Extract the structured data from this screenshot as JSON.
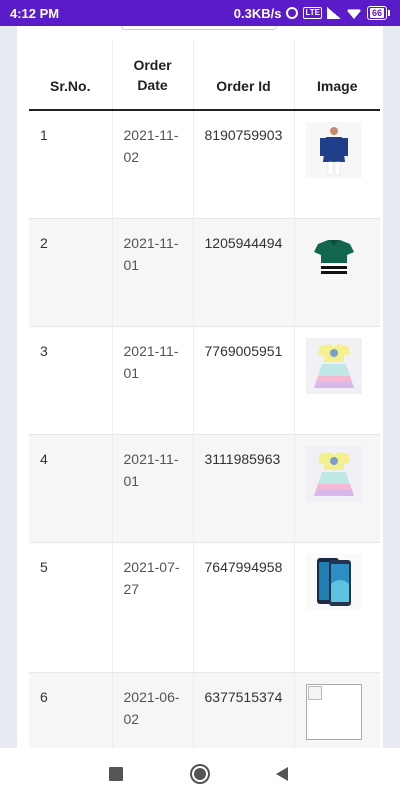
{
  "status_bar": {
    "time": "4:12 PM",
    "speed": "0.3KB/s",
    "battery": "66",
    "icons": [
      "alarm-icon",
      "volte-icon",
      "signal-icon",
      "wifi-icon",
      "battery-icon"
    ]
  },
  "table": {
    "headers": {
      "sr_no": "Sr.No.",
      "order_date": "Order Date",
      "order_id": "Order Id",
      "image": "Image"
    },
    "rows": [
      {
        "sr": "1",
        "date": "2021-11-02",
        "id": "8190759903",
        "image": "blue-kurta-product-image"
      },
      {
        "sr": "2",
        "date": "2021-11-01",
        "id": "1205944494",
        "image": "green-polo-shirt-product-image"
      },
      {
        "sr": "3",
        "date": "2021-11-01",
        "id": "7769005951",
        "image": "kids-frock-product-image"
      },
      {
        "sr": "4",
        "date": "2021-11-01",
        "id": "3111985963",
        "image": "kids-frock-product-image"
      },
      {
        "sr": "5",
        "date": "2021-07-27",
        "id": "7647994958",
        "image": "smartphone-product-image"
      },
      {
        "sr": "6",
        "date": "2021-06-02",
        "id": "6377515374",
        "image": "broken-image"
      }
    ]
  },
  "nav_bar": {
    "buttons": [
      "recents-square-icon",
      "home-circle-icon",
      "back-triangle-icon"
    ]
  },
  "colors": {
    "status_bar": "#5a1bc9",
    "page_bg": "#e9ebf3",
    "row_alt": "#f6f6f6"
  }
}
